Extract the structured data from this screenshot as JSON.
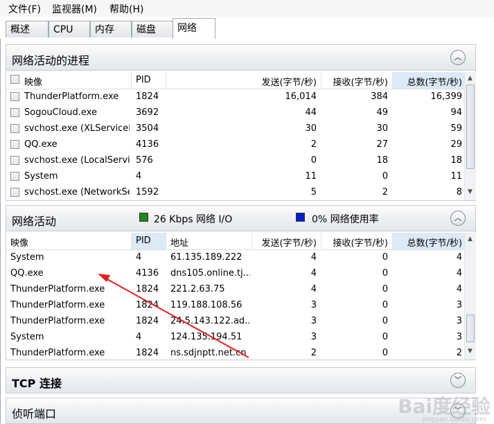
{
  "menu": [
    "文件(F)",
    "监视器(M)",
    "帮助(H)"
  ],
  "tabs": [
    "概述",
    "CPU",
    "内存",
    "磁盘",
    "网络"
  ],
  "processes": {
    "title": "网络活动的进程",
    "columns": [
      "映像",
      "PID",
      "发送(字节/秒)",
      "接收(字节/秒)",
      "总数(字节/秒)"
    ],
    "rows": [
      {
        "image": "ThunderPlatform.exe",
        "pid": "1824",
        "send": "16,014",
        "recv": "384",
        "total": "16,399"
      },
      {
        "image": "SogouCloud.exe",
        "pid": "3692",
        "send": "44",
        "recv": "49",
        "total": "94"
      },
      {
        "image": "svchost.exe (XLServiceP...",
        "pid": "3504",
        "send": "30",
        "recv": "30",
        "total": "59"
      },
      {
        "image": "QQ.exe",
        "pid": "4136",
        "send": "2",
        "recv": "27",
        "total": "29"
      },
      {
        "image": "svchost.exe (LocalServic...",
        "pid": "576",
        "send": "0",
        "recv": "18",
        "total": "18"
      },
      {
        "image": "System",
        "pid": "4",
        "send": "11",
        "recv": "0",
        "total": "11"
      },
      {
        "image": "svchost.exe (NetworkSe...",
        "pid": "1592",
        "send": "5",
        "recv": "2",
        "total": "8"
      }
    ]
  },
  "activity": {
    "title": "网络活动",
    "io_label": "26 Kbps 网络 I/O",
    "usage_label": "0% 网络使用率",
    "io_color": "#1c8a1c",
    "usage_color": "#0a1ec8",
    "columns": [
      "映像",
      "PID",
      "地址",
      "发送(字节/秒)",
      "接收(字节/秒)",
      "总数(字节/秒)"
    ],
    "rows": [
      {
        "image": "System",
        "pid": "4",
        "addr": "61.135.189.222",
        "send": "4",
        "recv": "0",
        "total": "4"
      },
      {
        "image": "QQ.exe",
        "pid": "4136",
        "addr": "dns105.online.tj....",
        "send": "4",
        "recv": "0",
        "total": "4"
      },
      {
        "image": "ThunderPlatform.exe",
        "pid": "1824",
        "addr": "221.2.63.75",
        "send": "4",
        "recv": "0",
        "total": "4"
      },
      {
        "image": "ThunderPlatform.exe",
        "pid": "1824",
        "addr": "119.188.108.56",
        "send": "3",
        "recv": "0",
        "total": "3"
      },
      {
        "image": "ThunderPlatform.exe",
        "pid": "1824",
        "addr": "24.5.143.122.ad...",
        "send": "3",
        "recv": "0",
        "total": "3"
      },
      {
        "image": "System",
        "pid": "4",
        "addr": "124.135.194.51",
        "send": "3",
        "recv": "0",
        "total": "3"
      },
      {
        "image": "ThunderPlatform.exe",
        "pid": "1824",
        "addr": "ns.sdjnptt.net.cn",
        "send": "2",
        "recv": "0",
        "total": "2"
      }
    ]
  },
  "tcp": {
    "title": "TCP 连接"
  },
  "listen": {
    "title": "侦听端口"
  },
  "watermark": {
    "main": "Bai度经验",
    "sub": "jingyan.baidu.com"
  }
}
